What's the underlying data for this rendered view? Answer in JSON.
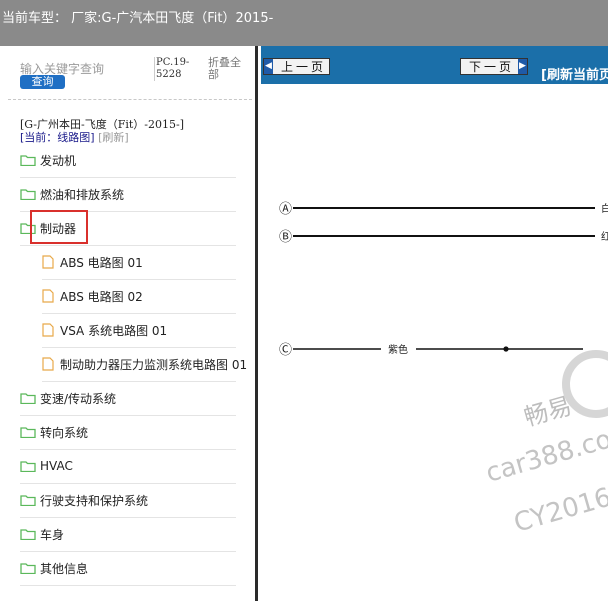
{
  "window": {
    "title": "当前车型： 厂家:G-广汽本田飞度（Fit）2015-"
  },
  "sidebar": {
    "search_placeholder": "输入关键字查询",
    "search_button": "查询",
    "pc_code": "PC.19-5228",
    "collapse_all": "折叠全部",
    "model": "[G-广州本田-飞度（Fit）-2015-]",
    "current_label": "[当前：线路图]",
    "refresh_label": "[刷新]",
    "tree": [
      {
        "label": "发动机"
      },
      {
        "label": "燃油和排放系统"
      },
      {
        "label": "制动器",
        "children": [
          "ABS 电路图 01",
          "ABS 电路图 02",
          "VSA 系统电路图 01",
          "制动助力器压力监测系统电路图 01"
        ]
      },
      {
        "label": "变速/传动系统"
      },
      {
        "label": "转向系统"
      },
      {
        "label": "HVAC"
      },
      {
        "label": "行驶支持和保护系统"
      },
      {
        "label": "车身"
      },
      {
        "label": "其他信息"
      }
    ]
  },
  "viewer": {
    "prev_label": "上一页",
    "next_label": "下一页",
    "refresh_label": "[刷新当前页]",
    "connectors": [
      {
        "mark": "Ⓐ",
        "wire_label": "白"
      },
      {
        "mark": "Ⓑ",
        "wire_label": "红"
      },
      {
        "mark": "Ⓒ",
        "wire_label": "紫色"
      }
    ],
    "watermark_lines": [
      "畅易",
      "car388.com",
      "CY2016"
    ]
  },
  "colors": {
    "accent": "#1b6fa9",
    "highlight_box": "#d9302c",
    "folder": "#5bb85b",
    "doc": "#e8a94a"
  }
}
